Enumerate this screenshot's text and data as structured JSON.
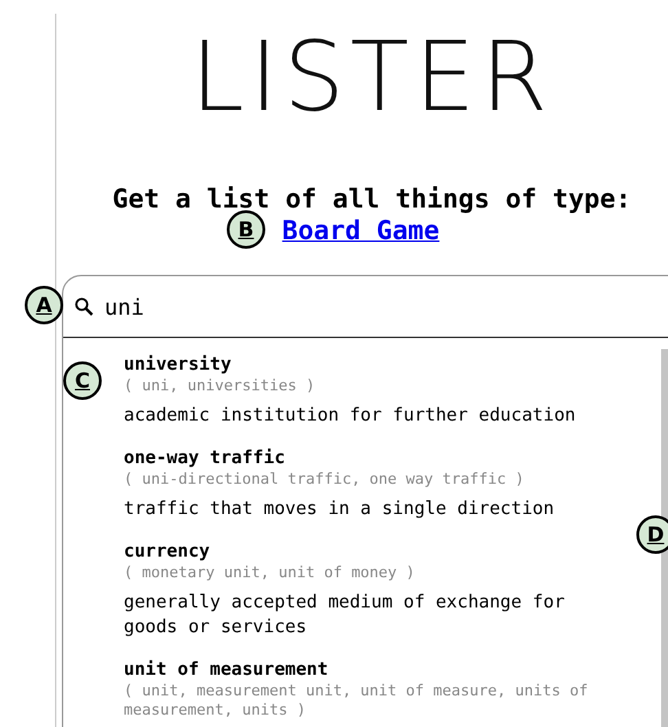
{
  "title": "LISTER",
  "prompt": "Get a list of all things of type:",
  "type_link": "Board Game",
  "search": {
    "value": "uni"
  },
  "results": [
    {
      "name": "university",
      "synonyms": "( uni, universities )",
      "description": "academic institution for further education"
    },
    {
      "name": "one-way traffic",
      "synonyms": "( uni-directional traffic, one way traffic )",
      "description": "traffic that moves in a single direction"
    },
    {
      "name": "currency",
      "synonyms": "( monetary unit, unit of money )",
      "description": "generally accepted medium of exchange for goods or services"
    },
    {
      "name": "unit of measurement",
      "synonyms": "( unit, measurement unit, unit of measure, units of measurement, units )"
    }
  ],
  "callouts": [
    {
      "label": "A"
    },
    {
      "label": "B"
    },
    {
      "label": "C"
    },
    {
      "label": "D"
    }
  ]
}
